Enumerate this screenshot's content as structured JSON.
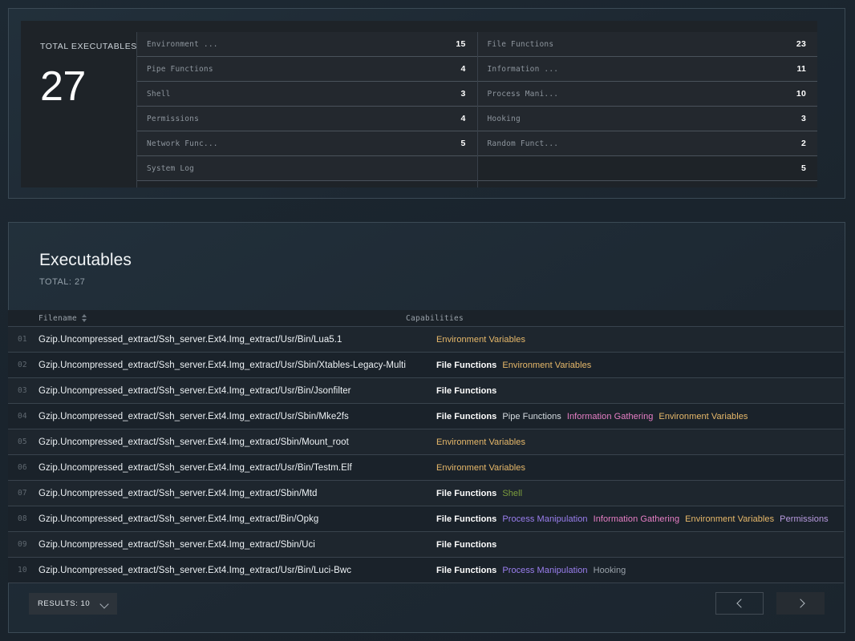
{
  "summary": {
    "total_label": "TOTAL EXECUTABLES",
    "total_value": "27",
    "column_left": [
      {
        "name": "Environment ...",
        "count": "15"
      },
      {
        "name": "Pipe Functions",
        "count": "4"
      },
      {
        "name": "Shell",
        "count": "3"
      },
      {
        "name": "Permissions",
        "count": "4"
      },
      {
        "name": "Network Func...",
        "count": "5"
      },
      {
        "name": "System Log",
        "count": ""
      }
    ],
    "column_right": [
      {
        "name": "File Functions",
        "count": "23"
      },
      {
        "name": "Information ...",
        "count": "11"
      },
      {
        "name": "Process Mani...",
        "count": "10"
      },
      {
        "name": "Hooking",
        "count": "3"
      },
      {
        "name": "Random Funct...",
        "count": "2"
      },
      {
        "name": "",
        "count": "5"
      }
    ]
  },
  "executables": {
    "title": "Executables",
    "total_text": "TOTAL: 27",
    "columns": {
      "filename": "Filename",
      "capabilities": "Capabilities"
    },
    "rows": [
      {
        "index": "01",
        "filename": "Gzip.Uncompressed_extract/Ssh_server.Ext4.Img_extract/Usr/Bin/Lua5.1",
        "capabilities": [
          {
            "label": "Environment Variables",
            "kind": "env"
          }
        ]
      },
      {
        "index": "02",
        "filename": "Gzip.Uncompressed_extract/Ssh_server.Ext4.Img_extract/Usr/Sbin/Xtables-Legacy-Multi",
        "capabilities": [
          {
            "label": "File Functions",
            "kind": "file"
          },
          {
            "label": "Environment Variables",
            "kind": "env"
          }
        ]
      },
      {
        "index": "03",
        "filename": "Gzip.Uncompressed_extract/Ssh_server.Ext4.Img_extract/Usr/Bin/Jsonfilter",
        "capabilities": [
          {
            "label": "File Functions",
            "kind": "file"
          }
        ]
      },
      {
        "index": "04",
        "filename": "Gzip.Uncompressed_extract/Ssh_server.Ext4.Img_extract/Usr/Sbin/Mke2fs",
        "capabilities": [
          {
            "label": "File Functions",
            "kind": "file"
          },
          {
            "label": "Pipe Functions",
            "kind": "pipe"
          },
          {
            "label": "Information Gathering",
            "kind": "info"
          },
          {
            "label": "Environment Variables",
            "kind": "env"
          }
        ]
      },
      {
        "index": "05",
        "filename": "Gzip.Uncompressed_extract/Ssh_server.Ext4.Img_extract/Sbin/Mount_root",
        "capabilities": [
          {
            "label": "Environment Variables",
            "kind": "env"
          }
        ]
      },
      {
        "index": "06",
        "filename": "Gzip.Uncompressed_extract/Ssh_server.Ext4.Img_extract/Usr/Bin/Testm.Elf",
        "capabilities": [
          {
            "label": "Environment Variables",
            "kind": "env"
          }
        ]
      },
      {
        "index": "07",
        "filename": "Gzip.Uncompressed_extract/Ssh_server.Ext4.Img_extract/Sbin/Mtd",
        "capabilities": [
          {
            "label": "File Functions",
            "kind": "file"
          },
          {
            "label": "Shell",
            "kind": "shell"
          }
        ]
      },
      {
        "index": "08",
        "filename": "Gzip.Uncompressed_extract/Ssh_server.Ext4.Img_extract/Bin/Opkg",
        "capabilities": [
          {
            "label": "File Functions",
            "kind": "file"
          },
          {
            "label": "Process Manipulation",
            "kind": "proc"
          },
          {
            "label": "Information Gathering",
            "kind": "info"
          },
          {
            "label": "Environment Variables",
            "kind": "env"
          },
          {
            "label": "Permissions",
            "kind": "perm"
          }
        ]
      },
      {
        "index": "09",
        "filename": "Gzip.Uncompressed_extract/Ssh_server.Ext4.Img_extract/Sbin/Uci",
        "capabilities": [
          {
            "label": "File Functions",
            "kind": "file"
          }
        ]
      },
      {
        "index": "10",
        "filename": "Gzip.Uncompressed_extract/Ssh_server.Ext4.Img_extract/Usr/Bin/Luci-Bwc",
        "capabilities": [
          {
            "label": "File Functions",
            "kind": "file"
          },
          {
            "label": "Process Manipulation",
            "kind": "proc"
          },
          {
            "label": "Hooking",
            "kind": "hook"
          }
        ]
      }
    ],
    "footer": {
      "results_label": "RESULTS:  10",
      "prev_icon": "chevron-left-icon",
      "next_icon": "chevron-right-icon"
    }
  },
  "colors": {
    "env": "#e8b96a",
    "info": "#e87fc6",
    "proc": "#9b7ff0",
    "perm": "#b99be0",
    "shell": "#7d9e3d",
    "file": "#ffffff",
    "hook": "#9aa2aa",
    "background": "#1b2630"
  }
}
